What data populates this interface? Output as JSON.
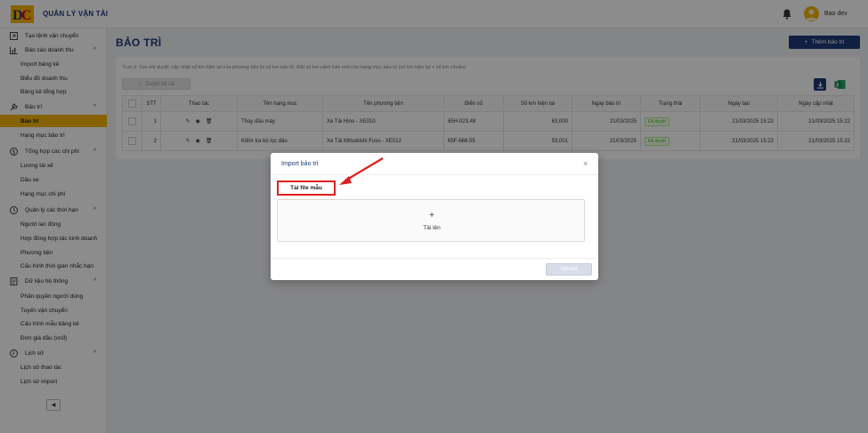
{
  "header": {
    "app_title": "QUẢN LÝ VẬN TẢI",
    "user_name": "Bao dev",
    "colors": {
      "brand": "#1f3a7a",
      "accent": "#f5b400"
    }
  },
  "sidebar": {
    "items": [
      {
        "type": "group",
        "label": "Tạo lệnh vận chuyển",
        "icon": "square-arrow-icon"
      },
      {
        "type": "group",
        "label": "Báo cáo doanh thu",
        "icon": "bar-chart-icon",
        "expanded": true
      },
      {
        "type": "sub",
        "label": "Import bảng kê"
      },
      {
        "type": "sub",
        "label": "Biểu đồ doanh thu"
      },
      {
        "type": "sub",
        "label": "Bảng kê tổng hợp"
      },
      {
        "type": "group",
        "label": "Bảo trì",
        "icon": "wrench-icon",
        "expanded": true
      },
      {
        "type": "sub",
        "label": "Bảo trì",
        "active": true
      },
      {
        "type": "sub",
        "label": "Hạng mục bảo trì"
      },
      {
        "type": "group",
        "label": "Tổng hợp các chi phí",
        "icon": "dollar-icon",
        "expanded": true
      },
      {
        "type": "sub",
        "label": "Lương tài xế"
      },
      {
        "type": "sub",
        "label": "Dầu xe"
      },
      {
        "type": "sub",
        "label": "Hạng mục chi phí"
      },
      {
        "type": "group",
        "label": "Quản lý các thời hạn",
        "icon": "clock-icon",
        "expanded": true
      },
      {
        "type": "sub",
        "label": "Người lao động"
      },
      {
        "type": "sub",
        "label": "Hợp đồng hợp tác kinh doanh"
      },
      {
        "type": "sub",
        "label": "Phương tiện"
      },
      {
        "type": "sub",
        "label": "Cấu hình thời gian nhắc hạn"
      },
      {
        "type": "group",
        "label": "Dữ liệu hệ thống",
        "icon": "document-icon",
        "expanded": true
      },
      {
        "type": "sub",
        "label": "Phân quyền người dùng"
      },
      {
        "type": "sub",
        "label": "Tuyến vận chuyển"
      },
      {
        "type": "sub",
        "label": "Cấu hình mẫu bảng kê"
      },
      {
        "type": "sub",
        "label": "Đơn giá dầu (vnđ)"
      },
      {
        "type": "group",
        "label": "Lịch sử",
        "icon": "history-icon",
        "expanded": true
      },
      {
        "type": "sub",
        "label": "Lịch sử thao tác"
      },
      {
        "type": "sub",
        "label": "Lịch sử import"
      }
    ],
    "collapse_icon": "chevron-left-icon"
  },
  "main": {
    "page_title": "BẢO TRÌ",
    "add_button": "Thêm bảo trì",
    "note": "*Lưu ý: Sau khi duyệt, cập nhật số km hiện tại của phương tiện từ số km bảo trì. Đặt số km cảnh báo mới cho hạng mục bảo trì (số km hiện tại + số km chuẩn).",
    "approve_button": "Duyệt tất cả",
    "table": {
      "columns": [
        "STT",
        "Thao tác",
        "Tên hạng mục",
        "Tên phương tiện",
        "Biển số",
        "Số km hiện tại",
        "Ngày bảo trì",
        "Trạng thái",
        "Ngày tạo",
        "Ngày cập nhật"
      ],
      "rows": [
        {
          "stt": "1",
          "item": "Thay dầu máy",
          "vehicle": "Xe Tải Hino - XE010",
          "plate": "65H-023.48",
          "km": "63,000",
          "maint_date": "21/03/2025",
          "status": "Đã duyệt",
          "created": "21/03/2025 15:22",
          "updated": "21/03/2025 15:22"
        },
        {
          "stt": "2",
          "item": "Kiểm tra bộ lọc dầu",
          "vehicle": "Xe Tải Mitsubishi Fuso - XE012",
          "plate": "65F-666.55",
          "km": "53,001",
          "maint_date": "21/03/2025",
          "status": "Đã duyệt",
          "created": "21/03/2025 15:22",
          "updated": "21/03/2025 15:22"
        }
      ]
    }
  },
  "modal": {
    "title": "Import bảo trì",
    "template_button": "Tải file mẫu",
    "drop_plus": "+",
    "drop_label": "Tải lên",
    "upload_button": "Upload",
    "close": "×"
  }
}
